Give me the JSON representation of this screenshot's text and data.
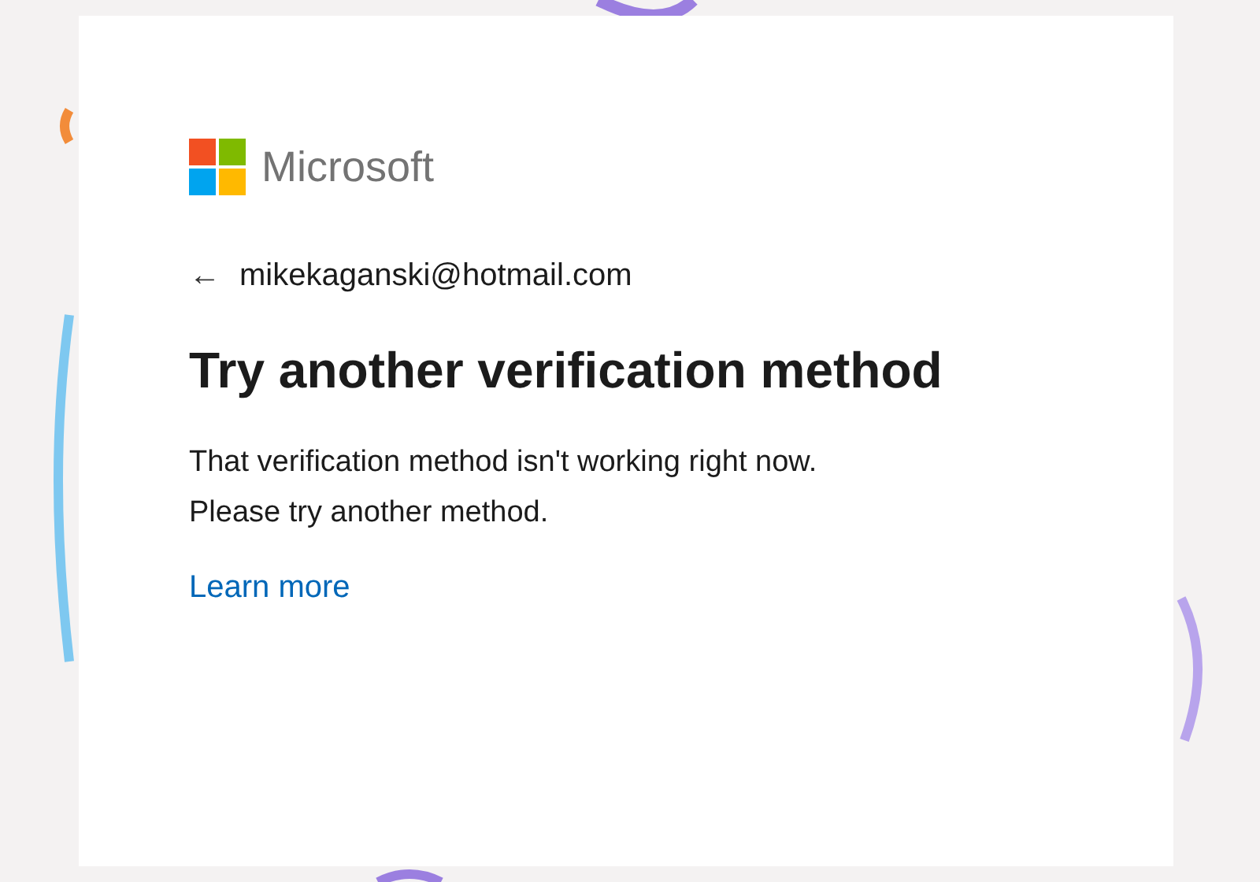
{
  "logo": {
    "text": "Microsoft"
  },
  "account": {
    "back_icon": "←",
    "email": "mikekaganski@hotmail.com"
  },
  "heading": "Try another verification method",
  "message": [
    "That verification method isn't working right now.",
    "Please try another method."
  ],
  "link": "Learn more"
}
